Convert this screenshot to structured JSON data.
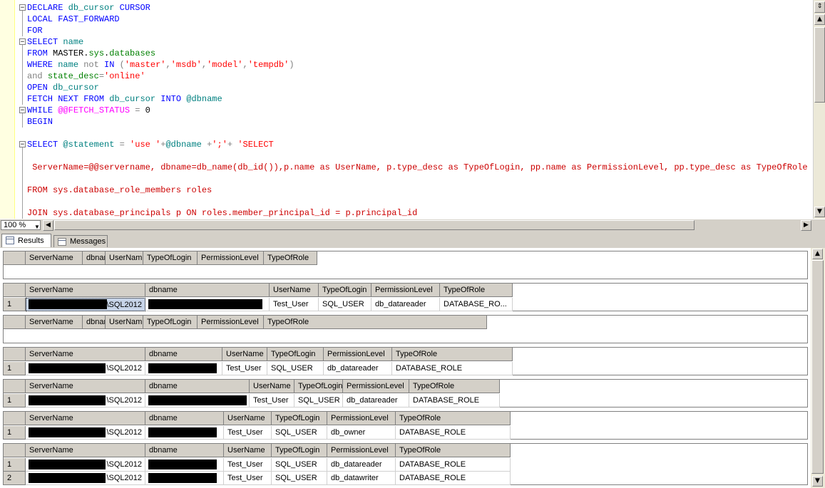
{
  "editor": {
    "lines": [
      [
        "DECLARE db_cursor CURSOR"
      ],
      [
        "LOCAL FAST_FORWARD"
      ],
      [
        "FOR"
      ],
      [
        "SELECT name"
      ],
      [
        "FROM MASTER.sys.databases"
      ],
      [
        "WHERE name not IN ('master','msdb','model','tempdb')"
      ],
      [
        "and state_desc='online'"
      ],
      [
        "OPEN db_cursor"
      ],
      [
        "FETCH NEXT FROM db_cursor INTO @dbname"
      ],
      [
        "WHILE @@FETCH_STATUS = 0"
      ],
      [
        "BEGIN"
      ],
      [
        ""
      ],
      [
        "SELECT @statement = 'use '+@dbname +';'+ 'SELECT"
      ],
      [
        ""
      ],
      [
        " ServerName=@@servername, dbname=db_name(db_id()),p.name as UserName, p.type_desc as TypeOfLogin, pp.name as PermissionLevel, pp.type_desc as TypeOfRole"
      ],
      [
        ""
      ],
      [
        "FROM sys.database_role_members roles"
      ],
      [
        ""
      ],
      [
        "JOIN sys.database_principals p ON roles.member_principal_id = p.principal_id"
      ]
    ]
  },
  "zoom": {
    "value": "100 %"
  },
  "tabs": {
    "results": "Results",
    "messages": "Messages"
  },
  "grids": [
    {
      "headers": [
        "ServerName",
        "dbname",
        "UserName",
        "TypeOfLogin",
        "PermissionLevel",
        "TypeOfRole"
      ],
      "rows": []
    },
    {
      "headers": [
        "ServerName",
        "dbname",
        "UserName",
        "TypeOfLogin",
        "PermissionLevel",
        "TypeOfRole"
      ],
      "rows": [
        {
          "num": "1",
          "cells": [
            "\\SQL2012",
            "",
            "Test_User",
            "SQL_USER",
            "db_datareader",
            "DATABASE_RO..."
          ]
        }
      ]
    },
    {
      "headers": [
        "ServerName",
        "dbname",
        "UserName",
        "TypeOfLogin",
        "PermissionLevel",
        "TypeOfRole"
      ],
      "rows": []
    },
    {
      "headers": [
        "ServerName",
        "dbname",
        "UserName",
        "TypeOfLogin",
        "PermissionLevel",
        "TypeOfRole"
      ],
      "rows": [
        {
          "num": "1",
          "cells": [
            "\\SQL2012",
            "",
            "Test_User",
            "SQL_USER",
            "db_datareader",
            "DATABASE_ROLE"
          ]
        }
      ]
    },
    {
      "headers": [
        "ServerName",
        "dbname",
        "UserName",
        "TypeOfLogin",
        "PermissionLevel",
        "TypeOfRole"
      ],
      "rows": [
        {
          "num": "1",
          "cells": [
            "\\SQL2012",
            "",
            "Test_User",
            "SQL_USER",
            "db_datareader",
            "DATABASE_ROLE"
          ]
        }
      ]
    },
    {
      "headers": [
        "ServerName",
        "dbname",
        "UserName",
        "TypeOfLogin",
        "PermissionLevel",
        "TypeOfRole"
      ],
      "rows": [
        {
          "num": "1",
          "cells": [
            "\\SQL2012",
            "",
            "Test_User",
            "SQL_USER",
            "db_owner",
            "DATABASE_ROLE"
          ]
        }
      ]
    },
    {
      "headers": [
        "ServerName",
        "dbname",
        "UserName",
        "TypeOfLogin",
        "PermissionLevel",
        "TypeOfRole"
      ],
      "rows": [
        {
          "num": "1",
          "cells": [
            "\\SQL2012",
            "",
            "Test_User",
            "SQL_USER",
            "db_datareader",
            "DATABASE_ROLE"
          ]
        },
        {
          "num": "2",
          "cells": [
            "\\SQL2012",
            "",
            "Test_User",
            "SQL_USER",
            "db_datawriter",
            "DATABASE_ROLE"
          ]
        }
      ]
    }
  ]
}
